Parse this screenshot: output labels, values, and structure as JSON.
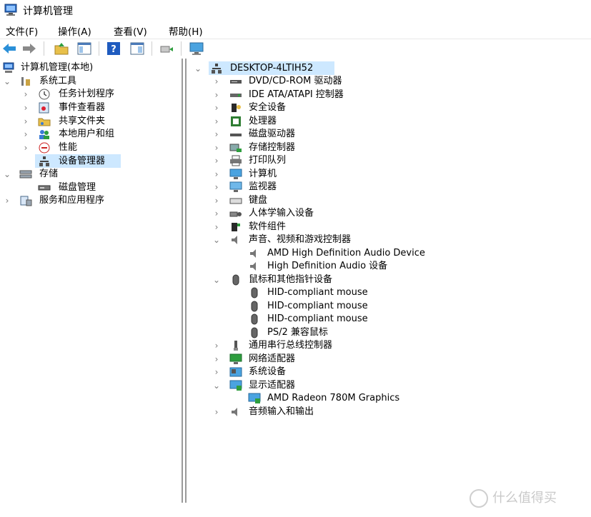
{
  "window": {
    "title": "计算机管理"
  },
  "menu": {
    "file": "文件(F)",
    "action": "操作(A)",
    "view": "查看(V)",
    "help": "帮助(H)"
  },
  "left_tree": {
    "root": "计算机管理(本地)",
    "system_tools": "系统工具",
    "task_scheduler": "任务计划程序",
    "event_viewer": "事件查看器",
    "shared_folders": "共享文件夹",
    "local_users": "本地用户和组",
    "performance": "性能",
    "device_manager": "设备管理器",
    "storage": "存储",
    "disk_management": "磁盘管理",
    "services_apps": "服务和应用程序"
  },
  "device_tree": {
    "computer": "DESKTOP-4LTIH52",
    "categories": {
      "dvd": "DVD/CD-ROM 驱动器",
      "ide": "IDE ATA/ATAPI 控制器",
      "security": "安全设备",
      "processor": "处理器",
      "disk": "磁盘驱动器",
      "storage_ctrl": "存储控制器",
      "print_queue": "打印队列",
      "computer": "计算机",
      "monitor": "监视器",
      "keyboard": "键盘",
      "hid": "人体学输入设备",
      "software": "软件组件",
      "sound": "声音、视频和游戏控制器",
      "mouse": "鼠标和其他指针设备",
      "usb": "通用串行总线控制器",
      "network": "网络适配器",
      "system": "系统设备",
      "display": "显示适配器",
      "audio_io": "音频输入和输出"
    },
    "sound_devices": [
      "AMD High Definition Audio Device",
      "High Definition Audio 设备"
    ],
    "mouse_devices": [
      "HID-compliant mouse",
      "HID-compliant mouse",
      "HID-compliant mouse",
      "PS/2 兼容鼠标"
    ],
    "display_devices": [
      "AMD Radeon 780M Graphics"
    ]
  },
  "watermark": "什么值得买",
  "colors": {
    "selection": "#cde8ff",
    "border": "#9a9a9a",
    "arrow": "#7a7a7a"
  }
}
